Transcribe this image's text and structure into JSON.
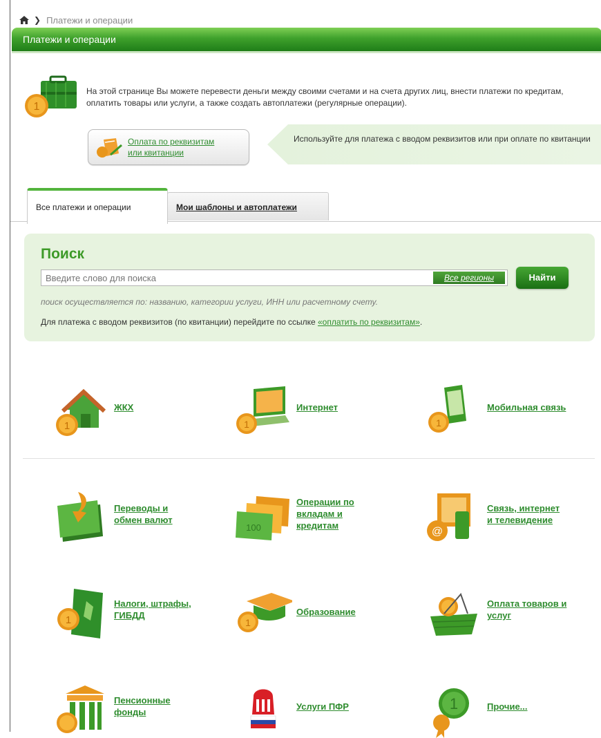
{
  "breadcrumb": {
    "current": "Платежи и операции"
  },
  "header": {
    "title": "Платежи и операции"
  },
  "intro": {
    "text": "На этой странице Вы можете перевести деньги между своими счетами и на счета других лиц, внести платежи по кредитам, оплатить товары или услуги, а также создать автоплатежи (регулярные операции).",
    "pay_button_line1": "Оплата по реквизитам",
    "pay_button_line2": "или квитанции",
    "hint": "Используйте для платежа с вводом реквизитов или при оплате по квитанции"
  },
  "tabs": [
    {
      "label": "Все платежи и операции",
      "active": true
    },
    {
      "label": "Мои шаблоны и автоплатежи",
      "active": false
    }
  ],
  "search": {
    "title": "Поиск",
    "placeholder": "Введите слово для поиска",
    "region_button": "Все регионы",
    "find_button": "Найти",
    "note": "поиск осуществляется по: названию, категории услуги, ИНН или расчетному счету.",
    "link_prefix": "Для платежа с вводом реквизитов (по квитанции) перейдите по ссылке ",
    "link_text": "«оплатить по реквизитам»",
    "link_suffix": "."
  },
  "categories": [
    {
      "line1": "ЖКХ",
      "line2": "",
      "line3": "",
      "icon": "house-coin-icon"
    },
    {
      "line1": "Интернет",
      "line2": "",
      "line3": "",
      "icon": "laptop-coin-icon"
    },
    {
      "line1": "Мобильная связь",
      "line2": "",
      "line3": "",
      "icon": "phone-coin-icon"
    },
    {
      "line1": "Переводы и",
      "line2": "обмен валют",
      "line3": "",
      "icon": "banknotes-arrow-icon"
    },
    {
      "line1": "Операции по",
      "line2": "вкладам и",
      "line3": "кредитам",
      "icon": "banknotes-icon"
    },
    {
      "line1": "Связь, интернет",
      "line2": "и телевидение",
      "line3": "",
      "icon": "tv-phone-icon"
    },
    {
      "line1": "Налоги, штрафы,",
      "line2": "ГИБДД",
      "line3": "",
      "icon": "emblem-coin-icon"
    },
    {
      "line1": "Образование",
      "line2": "",
      "line3": "",
      "icon": "graduation-cap-icon"
    },
    {
      "line1": "Оплата товаров и",
      "line2": "услуг",
      "line3": "",
      "icon": "basket-icon"
    },
    {
      "line1": "Пенсионные",
      "line2": "фонды",
      "line3": "",
      "icon": "bank-building-icon"
    },
    {
      "line1": "Услуги ПФР",
      "line2": "",
      "line3": "",
      "icon": "pfr-logo-icon"
    },
    {
      "line1": "Прочие...",
      "line2": "",
      "line3": "",
      "icon": "coin-ribbon-icon"
    }
  ],
  "colors": {
    "accent": "#3d9a28",
    "link": "#2e8c2e",
    "search_bg": "#e7f3df"
  }
}
